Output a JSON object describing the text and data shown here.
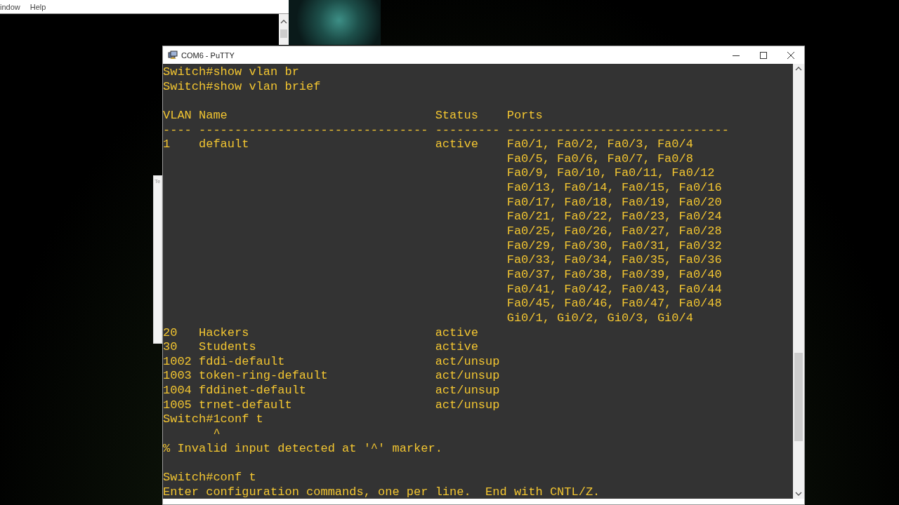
{
  "back_window": {
    "menu": [
      "indow",
      "Help"
    ],
    "side_panel_text": "Te"
  },
  "window": {
    "title": "COM6 - PuTTY"
  },
  "terminal": {
    "lines": [
      {
        "kind": "text",
        "text": "Switch#show vlan br"
      },
      {
        "kind": "text",
        "text": "Switch#show vlan brief"
      },
      {
        "kind": "blank"
      },
      {
        "kind": "text",
        "text": "VLAN Name                             Status    Ports"
      },
      {
        "kind": "text",
        "text": "---- -------------------------------- --------- -------------------------------"
      },
      {
        "kind": "text",
        "text": "1    default                          active    Fa0/1, Fa0/2, Fa0/3, Fa0/4"
      },
      {
        "kind": "text",
        "text": "                                                Fa0/5, Fa0/6, Fa0/7, Fa0/8"
      },
      {
        "kind": "text",
        "text": "                                                Fa0/9, Fa0/10, Fa0/11, Fa0/12"
      },
      {
        "kind": "text",
        "text": "                                                Fa0/13, Fa0/14, Fa0/15, Fa0/16"
      },
      {
        "kind": "text",
        "text": "                                                Fa0/17, Fa0/18, Fa0/19, Fa0/20"
      },
      {
        "kind": "text",
        "text": "                                                Fa0/21, Fa0/22, Fa0/23, Fa0/24"
      },
      {
        "kind": "text",
        "text": "                                                Fa0/25, Fa0/26, Fa0/27, Fa0/28"
      },
      {
        "kind": "text",
        "text": "                                                Fa0/29, Fa0/30, Fa0/31, Fa0/32"
      },
      {
        "kind": "text",
        "text": "                                                Fa0/33, Fa0/34, Fa0/35, Fa0/36"
      },
      {
        "kind": "text",
        "text": "                                                Fa0/37, Fa0/38, Fa0/39, Fa0/40"
      },
      {
        "kind": "text",
        "text": "                                                Fa0/41, Fa0/42, Fa0/43, Fa0/44"
      },
      {
        "kind": "text",
        "text": "                                                Fa0/45, Fa0/46, Fa0/47, Fa0/48"
      },
      {
        "kind": "text",
        "text": "                                                Gi0/1, Gi0/2, Gi0/3, Gi0/4"
      },
      {
        "kind": "text",
        "text": "20   Hackers                          active"
      },
      {
        "kind": "text",
        "text": "30   Students                         active"
      },
      {
        "kind": "text",
        "text": "1002 fddi-default                     act/unsup"
      },
      {
        "kind": "text",
        "text": "1003 token-ring-default               act/unsup"
      },
      {
        "kind": "text",
        "text": "1004 fddinet-default                  act/unsup"
      },
      {
        "kind": "text",
        "text": "1005 trnet-default                    act/unsup"
      },
      {
        "kind": "text",
        "text": "Switch#1conf t"
      },
      {
        "kind": "text",
        "text": "       ^"
      },
      {
        "kind": "text",
        "text": "% Invalid input detected at '^' marker."
      },
      {
        "kind": "blank"
      },
      {
        "kind": "text",
        "text": "Switch#conf t"
      },
      {
        "kind": "text",
        "text": "Enter configuration commands, one per line.  End with CNTL/Z."
      }
    ]
  }
}
